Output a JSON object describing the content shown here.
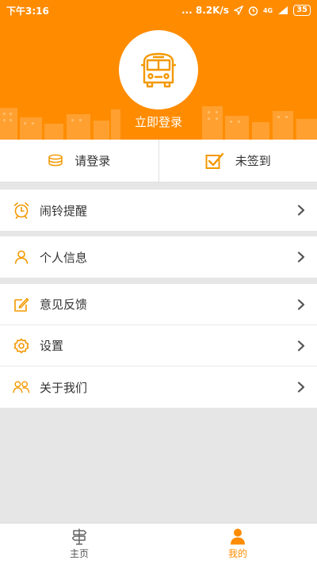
{
  "status_bar": {
    "time": "下午3:16",
    "speed": "8.2K/s",
    "network": "4G",
    "battery": "35"
  },
  "header": {
    "login_link": "立即登录"
  },
  "actions": {
    "login_label": "请登录",
    "checkin_label": "未签到"
  },
  "menu": {
    "alarm": "闹铃提醒",
    "profile": "个人信息",
    "feedback": "意见反馈",
    "settings": "设置",
    "about": "关于我们"
  },
  "bottom_nav": {
    "home": "主页",
    "mine": "我的"
  },
  "colors": {
    "accent": "#ff8c00",
    "background": "#e6e6e6"
  }
}
